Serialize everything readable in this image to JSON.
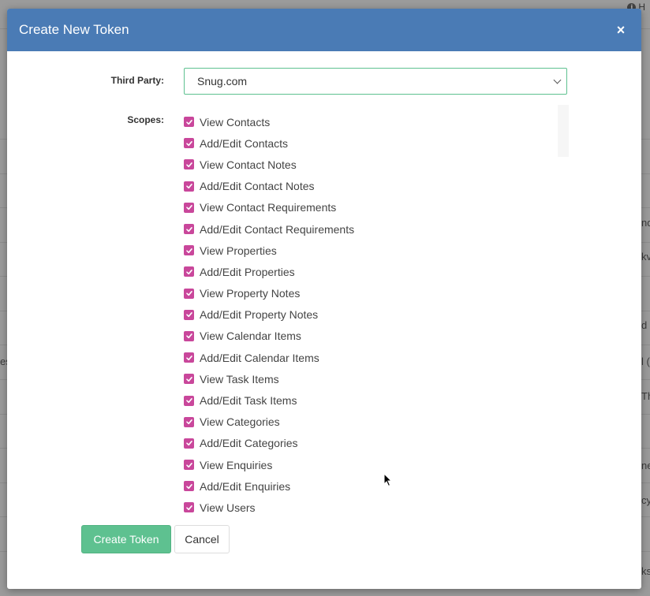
{
  "background": {
    "help_link": "H",
    "fragments_right": [
      "nq",
      "kv",
      "d [",
      "l (",
      "Th",
      "ne",
      "cyl",
      "ks"
    ],
    "fragment_left": "es"
  },
  "modal": {
    "title": "Create New Token",
    "close_icon": "×",
    "third_party": {
      "label": "Third Party:",
      "value": "Snug.com"
    },
    "scopes": {
      "label": "Scopes:",
      "items": [
        {
          "label": "View Contacts",
          "checked": true
        },
        {
          "label": "Add/Edit Contacts",
          "checked": true
        },
        {
          "label": "View Contact Notes",
          "checked": true
        },
        {
          "label": "Add/Edit Contact Notes",
          "checked": true
        },
        {
          "label": "View Contact Requirements",
          "checked": true
        },
        {
          "label": "Add/Edit Contact Requirements",
          "checked": true
        },
        {
          "label": "View Properties",
          "checked": true
        },
        {
          "label": "Add/Edit Properties",
          "checked": true
        },
        {
          "label": "View Property Notes",
          "checked": true
        },
        {
          "label": "Add/Edit Property Notes",
          "checked": true
        },
        {
          "label": "View Calendar Items",
          "checked": true
        },
        {
          "label": "Add/Edit Calendar Items",
          "checked": true
        },
        {
          "label": "View Task Items",
          "checked": true
        },
        {
          "label": "Add/Edit Task Items",
          "checked": true
        },
        {
          "label": "View Categories",
          "checked": true
        },
        {
          "label": "Add/Edit Categories",
          "checked": true
        },
        {
          "label": "View Enquiries",
          "checked": true
        },
        {
          "label": "Add/Edit Enquiries",
          "checked": true
        },
        {
          "label": "View Users",
          "checked": true
        }
      ]
    },
    "buttons": {
      "create": "Create Token",
      "cancel": "Cancel"
    }
  },
  "colors": {
    "header": "#4a7bb5",
    "primary_button": "#5ec190",
    "checkbox": "#c9479b"
  }
}
